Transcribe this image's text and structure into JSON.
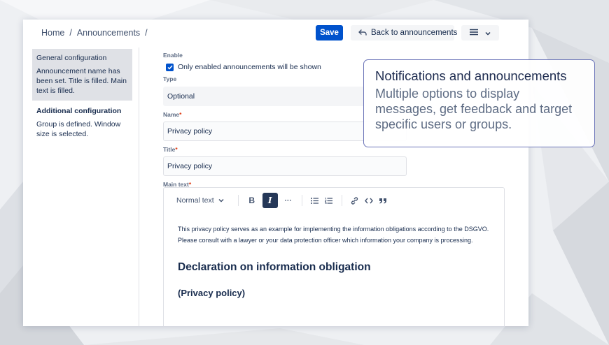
{
  "breadcrumb": {
    "home": "Home",
    "sep": "/",
    "section": "Announcements",
    "trail_sep": "/"
  },
  "header": {
    "save_label": "Save",
    "back_label": "Back to announcements"
  },
  "sidebar": {
    "items": [
      {
        "title": "General configuration",
        "desc": "Announcement name has been set. Title is filled. Main text is filled."
      },
      {
        "title": "Additional configuration",
        "desc": "Group is defined. Window size is selected."
      }
    ]
  },
  "form": {
    "enable_label": "Enable",
    "enable_checkbox_label": "Only enabled announcements will be shown",
    "type_label": "Type",
    "type_value": "Optional",
    "name_label": "Name",
    "name_value": "Privacy policy",
    "title_label": "Title",
    "title_value": "Privacy policy",
    "main_text_label": "Main text",
    "required_marker": "*"
  },
  "editor": {
    "text_style": "Normal text",
    "bold_label": "B",
    "italic_label": "I",
    "more_label": "···",
    "paragraph": "This privacy policy serves as an example for implementing the information obligations according to the DSGVO. Please consult with a lawyer or your data protection officer which information your company is processing.",
    "heading1": "Declaration on information obligation",
    "heading2": "(Privacy policy)"
  },
  "callout": {
    "title": "Notifications and announcements",
    "text": "Multiple options to display messages, get feedback and target specific users or groups."
  },
  "colors": {
    "primary": "#0052cc",
    "text": "#172b4d",
    "callout_border": "#6b74b8"
  }
}
